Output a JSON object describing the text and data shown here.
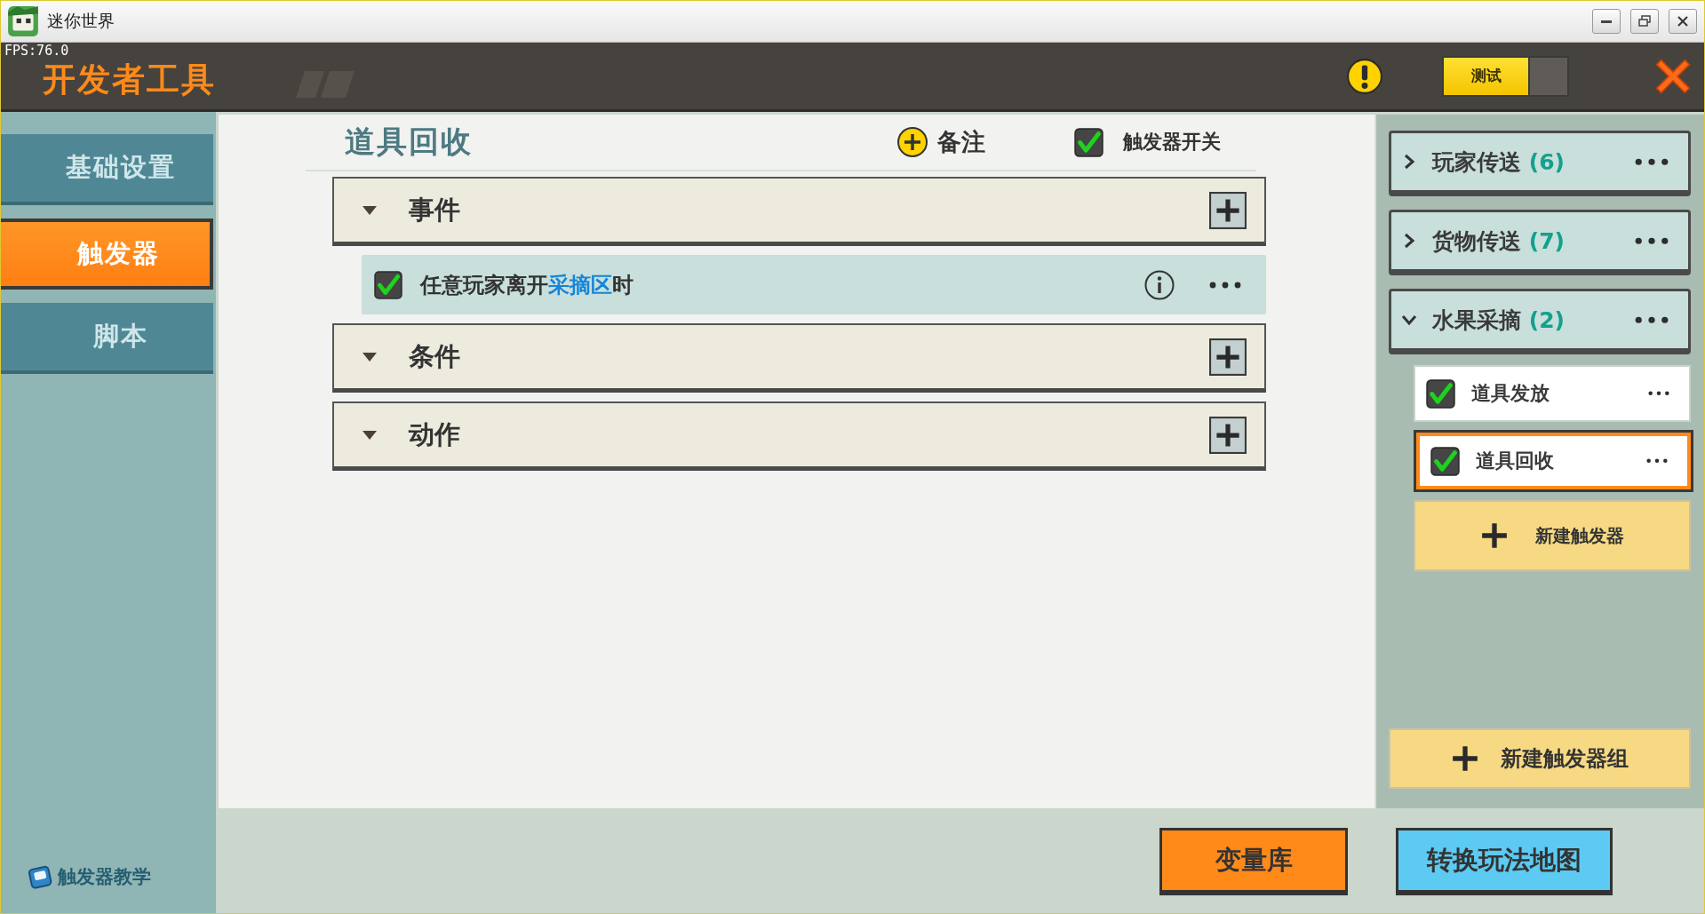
{
  "window": {
    "title": "迷你世界",
    "fps": "FPS:76.0"
  },
  "header": {
    "title": "开发者工具",
    "test_label": "测试"
  },
  "sidebar": {
    "tabs": [
      {
        "label": "基础设置",
        "selected": false
      },
      {
        "label": "触发器",
        "selected": true
      },
      {
        "label": "脚本",
        "selected": false
      }
    ],
    "tutorial_link": "触发器教学"
  },
  "editor": {
    "title": "道具回收",
    "note_button": "备注",
    "trigger_switch": {
      "label": "触发器开关",
      "checked": true
    },
    "sections": [
      {
        "title": "事件",
        "expanded": true,
        "items": [
          {
            "checked": true,
            "parts": [
              {
                "kind": "plain",
                "text": "任意玩家离开"
              },
              {
                "kind": "link",
                "text": "采摘区"
              },
              {
                "kind": "plain",
                "text": "时"
              }
            ]
          }
        ]
      },
      {
        "title": "条件",
        "expanded": true
      },
      {
        "title": "动作",
        "expanded": true
      }
    ]
  },
  "trigger_groups": [
    {
      "name": "玩家传送",
      "count": "(6)",
      "expanded": false
    },
    {
      "name": "货物传送",
      "count": "(7)",
      "expanded": false
    },
    {
      "name": "水果采摘",
      "count": "(2)",
      "expanded": true,
      "triggers": [
        {
          "name": "道具发放",
          "checked": true,
          "selected": false
        },
        {
          "name": "道具回收",
          "checked": true,
          "selected": true
        }
      ]
    }
  ],
  "new_trigger_button": "新建触发器",
  "new_group_button": "新建触发器组",
  "bottom_buttons": [
    {
      "label": "变量库",
      "color": "#ff8a1a"
    },
    {
      "label": "转换玩法地图",
      "color": "#5ccaf2"
    }
  ]
}
